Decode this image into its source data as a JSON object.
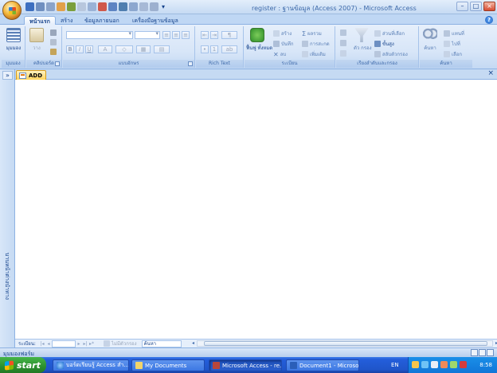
{
  "window": {
    "title": "register : ฐานข้อมูล (Access 2007) - Microsoft Access"
  },
  "ribbon": {
    "tabs": [
      "หน้าแรก",
      "สร้าง",
      "ข้อมูลภายนอก",
      "เครื่องมือฐานข้อมูล"
    ],
    "active_tab": "หน้าแรก",
    "groups": {
      "views": {
        "label": "มุมมอง",
        "button": "มุมมอง"
      },
      "clipboard": {
        "label": "คลิปบอร์ด",
        "paste": "วาง"
      },
      "font": {
        "label": "แบบอักษร"
      },
      "richtext": {
        "label": "Rich Text"
      },
      "records": {
        "label": "ระเบียน",
        "refresh": "ฟื้นฟู ทั้งหมด",
        "new": "สร้าง",
        "save": "บันทึก",
        "delete": "ลบ",
        "totals": "ผลรวม",
        "spelling": "การสะกด",
        "more": "เพิ่มเติม"
      },
      "sort_filter": {
        "label": "เรียงลำดับและกรอง",
        "filter": "ตัว กรอง",
        "selection": "ส่วนที่เลือก",
        "advanced": "ขั้นสูง",
        "toggle": "สลับตัวกรอง"
      },
      "find": {
        "label": "ค้นหา",
        "find": "ค้นหา",
        "replace": "แทนที่",
        "goto": "ไปที่",
        "select": "เลือก"
      }
    }
  },
  "nav_pane": {
    "label": "บานหน้าต่างนำทาง"
  },
  "document": {
    "tab_label": "ADD"
  },
  "record_nav": {
    "label": "ระเบียน:",
    "nofilter": "ไม่มีตัวกรอง",
    "search": "ค้นหา"
  },
  "status": {
    "text": "มุมมองฟอร์ม"
  },
  "taskbar": {
    "start": "start",
    "tasks": [
      "บอร์ดเรียนรู้ Access สำ...",
      "My Documents",
      "Microsoft Access - re...",
      "Document1 - Microsof..."
    ],
    "active_task": 2,
    "lang": "EN",
    "clock": "8:58"
  },
  "colors": {
    "ribbon_bg": "#d8e6f8",
    "accent_text": "#15428b",
    "doc_tab": "#ffd45e",
    "taskbar": "#245edb",
    "start": "#2c8f2f"
  }
}
